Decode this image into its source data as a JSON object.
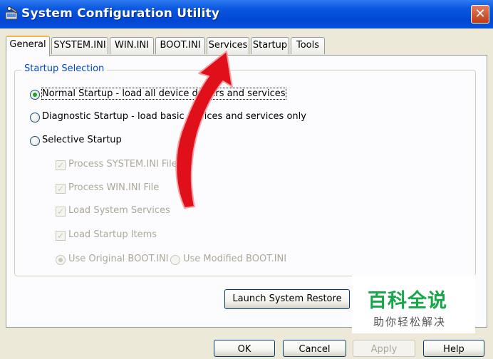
{
  "window": {
    "title": "System Configuration Utility",
    "close_glyph": "✕"
  },
  "tabs": [
    {
      "label": "General",
      "active": true
    },
    {
      "label": "SYSTEM.INI",
      "active": false
    },
    {
      "label": "WIN.INI",
      "active": false
    },
    {
      "label": "BOOT.INI",
      "active": false
    },
    {
      "label": "Services",
      "active": false
    },
    {
      "label": "Startup",
      "active": false
    },
    {
      "label": "Tools",
      "active": false
    }
  ],
  "startup_selection": {
    "group_label": "Startup Selection",
    "normal": {
      "label": "Normal Startup - load all device drivers and services",
      "selected": true
    },
    "diagnostic": {
      "label": "Diagnostic Startup - load basic devices and services only",
      "selected": false
    },
    "selective": {
      "label": "Selective Startup",
      "selected": false
    },
    "options": [
      {
        "label": "Process SYSTEM.INI File",
        "checked": true,
        "enabled": false
      },
      {
        "label": "Process WIN.INI File",
        "checked": true,
        "enabled": false
      },
      {
        "label": "Load System Services",
        "checked": true,
        "enabled": false
      },
      {
        "label": "Load Startup Items",
        "checked": true,
        "enabled": false
      }
    ],
    "boot_original": {
      "label": "Use Original BOOT.INI",
      "selected": true,
      "enabled": false
    },
    "boot_modified": {
      "label": "Use Modified BOOT.INI",
      "selected": false,
      "enabled": false
    },
    "launch_restore_label": "Launch System Restore"
  },
  "footer": {
    "ok_label": "OK",
    "cancel_label": "Cancel",
    "apply_label": "Apply",
    "help_label": "Help"
  },
  "watermark": {
    "title": "百科全说",
    "subtitle": "助你轻松解决"
  },
  "colors": {
    "titlebar": "#0047D6",
    "group_label": "#0046D5",
    "annotation_arrow": "#E0101A",
    "watermark_green": "#17A64A"
  }
}
